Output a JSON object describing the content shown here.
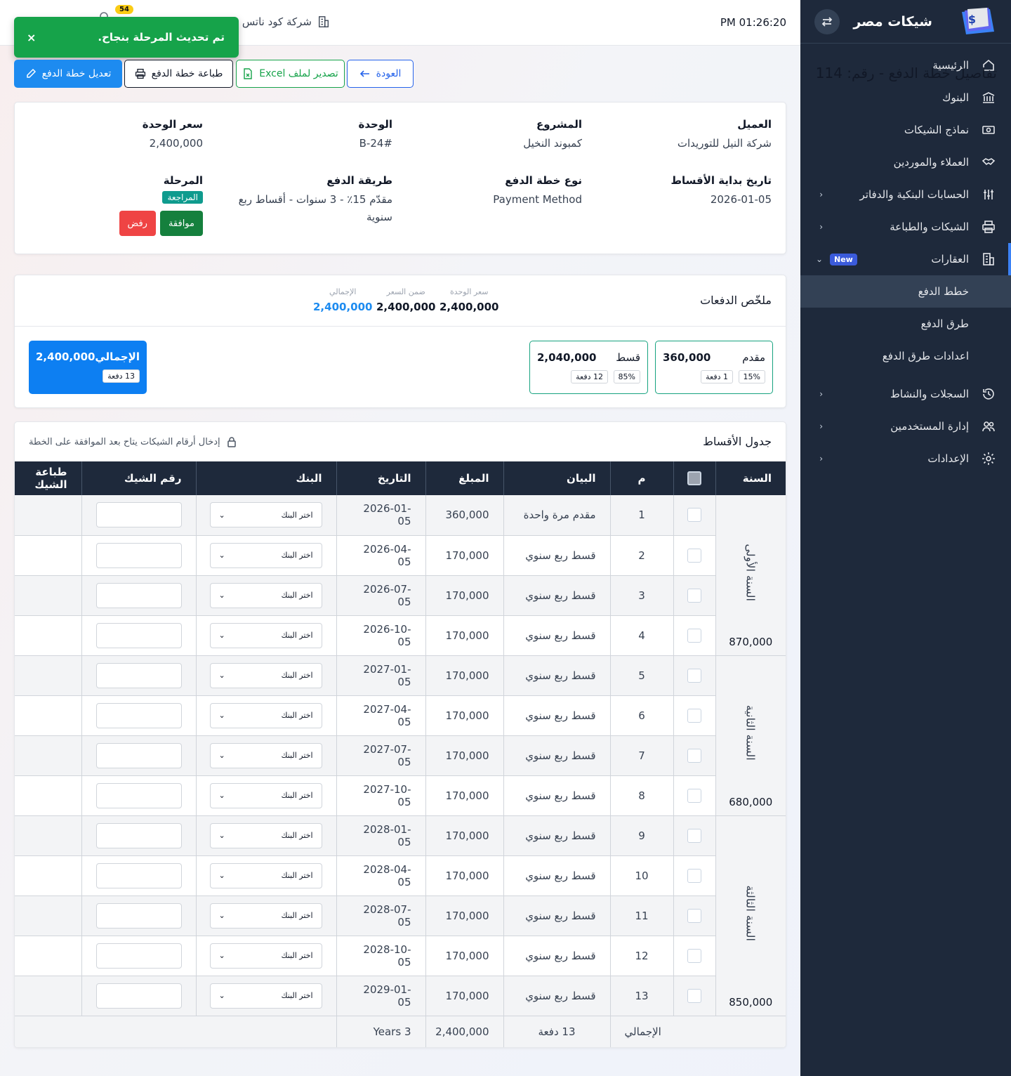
{
  "sidebar": {
    "brand": "شيكات مصر",
    "items": [
      {
        "label": "الرئيسية",
        "icon": "home-icon"
      },
      {
        "label": "البنوك",
        "icon": "bank-icon"
      },
      {
        "label": "نماذج الشيكات",
        "icon": "check-template-icon"
      },
      {
        "label": "العملاء والموردين",
        "icon": "handshake-icon"
      },
      {
        "label": "الحسابات البنكية والدفاتر",
        "icon": "sliders-icon"
      },
      {
        "label": "الشيكات والطباعة",
        "icon": "printer-icon"
      },
      {
        "label": "العقارات",
        "icon": "building-icon",
        "badge": "New"
      },
      {
        "label": "السجلات والنشاط",
        "icon": "history-icon"
      },
      {
        "label": "إدارة المستخدمين",
        "icon": "users-icon"
      },
      {
        "label": "الإعدادات",
        "icon": "settings-icon"
      }
    ],
    "sub": [
      "خطط الدفع",
      "طرق الدفع",
      "اعدادات طرق الدفع"
    ]
  },
  "topbar": {
    "time": "PM 01:26:20",
    "company": "شركة كود ناتس",
    "badge": "54"
  },
  "toast": {
    "message": "تم تحديث المرحلة بنجاح.",
    "close": "×"
  },
  "page": {
    "title": "تفاصيل خطة الدفع - رقم: 114"
  },
  "buttons": {
    "back": "العودة",
    "excel": "تصدير لملف Excel",
    "print": "طباعة خطة الدفع",
    "edit": "تعديل خطة الدفع"
  },
  "info": {
    "client_k": "العميل",
    "client_v": "شركة النيل للتوريدات",
    "project_k": "المشروع",
    "project_v": "كمبوند النخيل",
    "unit_k": "الوحدة",
    "unit_v": "B-24#",
    "price_k": "سعر الوحدة",
    "price_v": "2,400,000",
    "start_k": "تاريخ بداية الأقساط",
    "start_v": "2026-01-05",
    "type_k": "نوع خطة الدفع",
    "type_v": "Payment Method",
    "method_k": "طريقة الدفع",
    "method_v": "مقدّم 15٪ - 3 سنوات - أقساط ربع سنوية",
    "stage_k": "المرحلة",
    "stage_v": "المراجعة",
    "approve": "موافقة",
    "reject": "رفض"
  },
  "summary": {
    "title": "ملخّص الدفعات",
    "unit_price_l": "سعر الوحدة",
    "unit_price_v": "2,400,000",
    "within_l": "ضمن السعر",
    "within_v": "2,400,000",
    "total_l": "الإجمالي",
    "total_v": "2,400,000",
    "down": {
      "label": "مقدم",
      "amount": "360,000",
      "pct": "15%",
      "count": "1 دفعة"
    },
    "inst": {
      "label": "قسط",
      "amount": "2,040,000",
      "pct": "85%",
      "count": "12 دفعة"
    },
    "total": {
      "label": "الإجمالي",
      "amount": "2,400,000",
      "count": "13 دفعة"
    }
  },
  "table": {
    "title": "جدول الأقساط",
    "note": "إدخال أرقام الشيكات يتاح بعد الموافقة على الخطة",
    "headers": {
      "year": "السنة",
      "no": "م",
      "desc": "البيان",
      "amount": "المبلغ",
      "date": "التاريخ",
      "bank": "البنك",
      "check": "رقم الشيك",
      "print": "طباعة الشيك"
    },
    "bank_placeholder": "اختر البنك",
    "years": [
      {
        "label": "السنة الأولى",
        "total": "870,000"
      },
      {
        "label": "السنة الثانية",
        "total": "680,000"
      },
      {
        "label": "السنة الثالثة",
        "total": "850,000"
      }
    ],
    "rows": [
      {
        "no": "1",
        "desc": "مقدم مرة واحدة",
        "amount": "360,000",
        "date": "2026-01-05"
      },
      {
        "no": "2",
        "desc": "قسط ربع سنوي",
        "amount": "170,000",
        "date": "2026-04-05"
      },
      {
        "no": "3",
        "desc": "قسط ربع سنوي",
        "amount": "170,000",
        "date": "2026-07-05"
      },
      {
        "no": "4",
        "desc": "قسط ربع سنوي",
        "amount": "170,000",
        "date": "2026-10-05"
      },
      {
        "no": "5",
        "desc": "قسط ربع سنوي",
        "amount": "170,000",
        "date": "2027-01-05"
      },
      {
        "no": "6",
        "desc": "قسط ربع سنوي",
        "amount": "170,000",
        "date": "2027-04-05"
      },
      {
        "no": "7",
        "desc": "قسط ربع سنوي",
        "amount": "170,000",
        "date": "2027-07-05"
      },
      {
        "no": "8",
        "desc": "قسط ربع سنوي",
        "amount": "170,000",
        "date": "2027-10-05"
      },
      {
        "no": "9",
        "desc": "قسط ربع سنوي",
        "amount": "170,000",
        "date": "2028-01-05"
      },
      {
        "no": "10",
        "desc": "قسط ربع سنوي",
        "amount": "170,000",
        "date": "2028-04-05"
      },
      {
        "no": "11",
        "desc": "قسط ربع سنوي",
        "amount": "170,000",
        "date": "2028-07-05"
      },
      {
        "no": "12",
        "desc": "قسط ربع سنوي",
        "amount": "170,000",
        "date": "2028-10-05"
      },
      {
        "no": "13",
        "desc": "قسط ربع سنوي",
        "amount": "170,000",
        "date": "2029-01-05"
      }
    ],
    "footer": {
      "label": "الإجمالي",
      "count": "13 دفعة",
      "amount": "2,400,000",
      "years": "3 Years"
    }
  }
}
